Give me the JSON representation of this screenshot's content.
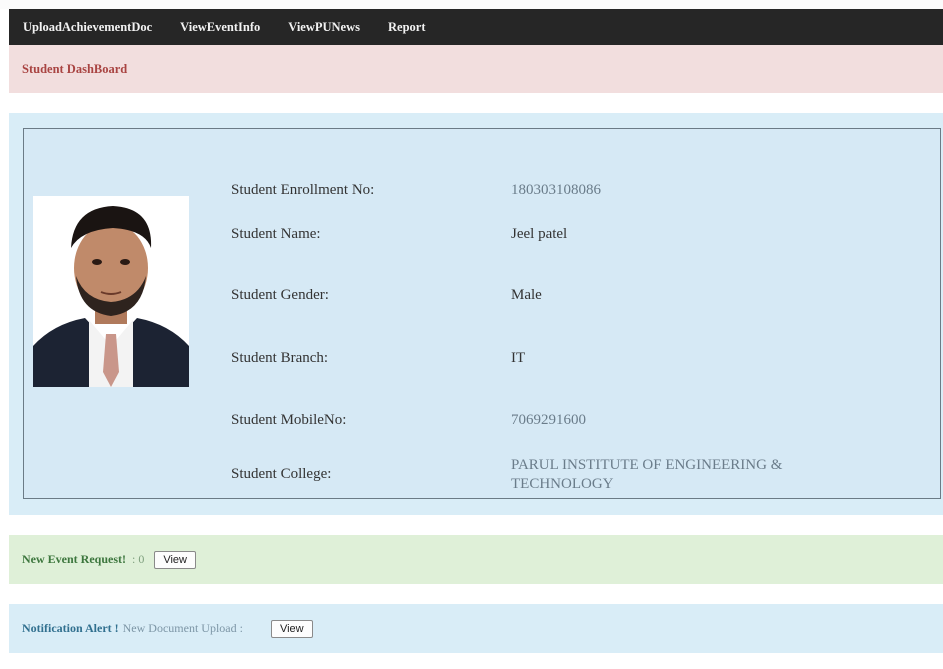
{
  "nav": {
    "items": [
      "UploadAchievementDoc",
      "ViewEventInfo",
      "ViewPUNews",
      "Report"
    ]
  },
  "dashboard": {
    "title": "Student DashBoard"
  },
  "student": {
    "fields": [
      {
        "label": "Student Enrollment No:",
        "value": "180303108086"
      },
      {
        "label": "Student Name:",
        "value": "Jeel patel"
      },
      {
        "label": "Student Gender:",
        "value": "Male"
      },
      {
        "label": "Student Branch:",
        "value": "IT"
      },
      {
        "label": "Student MobileNo:",
        "value": "7069291600"
      },
      {
        "label": "Student College:",
        "value_line1": "PARUL INSTITUTE OF ENGINEERING &",
        "value_line2": "TECHNOLOGY"
      }
    ]
  },
  "event_request": {
    "label": "New Event Request!",
    "count": ": 0",
    "button": "View"
  },
  "notification": {
    "label": "Notification Alert !",
    "sub": "New Document Upload :",
    "button": "View"
  },
  "colors": {
    "navbar": "#262626",
    "danger_bg": "#f2dede",
    "danger_text": "#a94442",
    "info_bg": "#d9edf7",
    "success_bg": "#dff0d8",
    "success_text": "#3c763d",
    "info_text": "#31708f"
  }
}
